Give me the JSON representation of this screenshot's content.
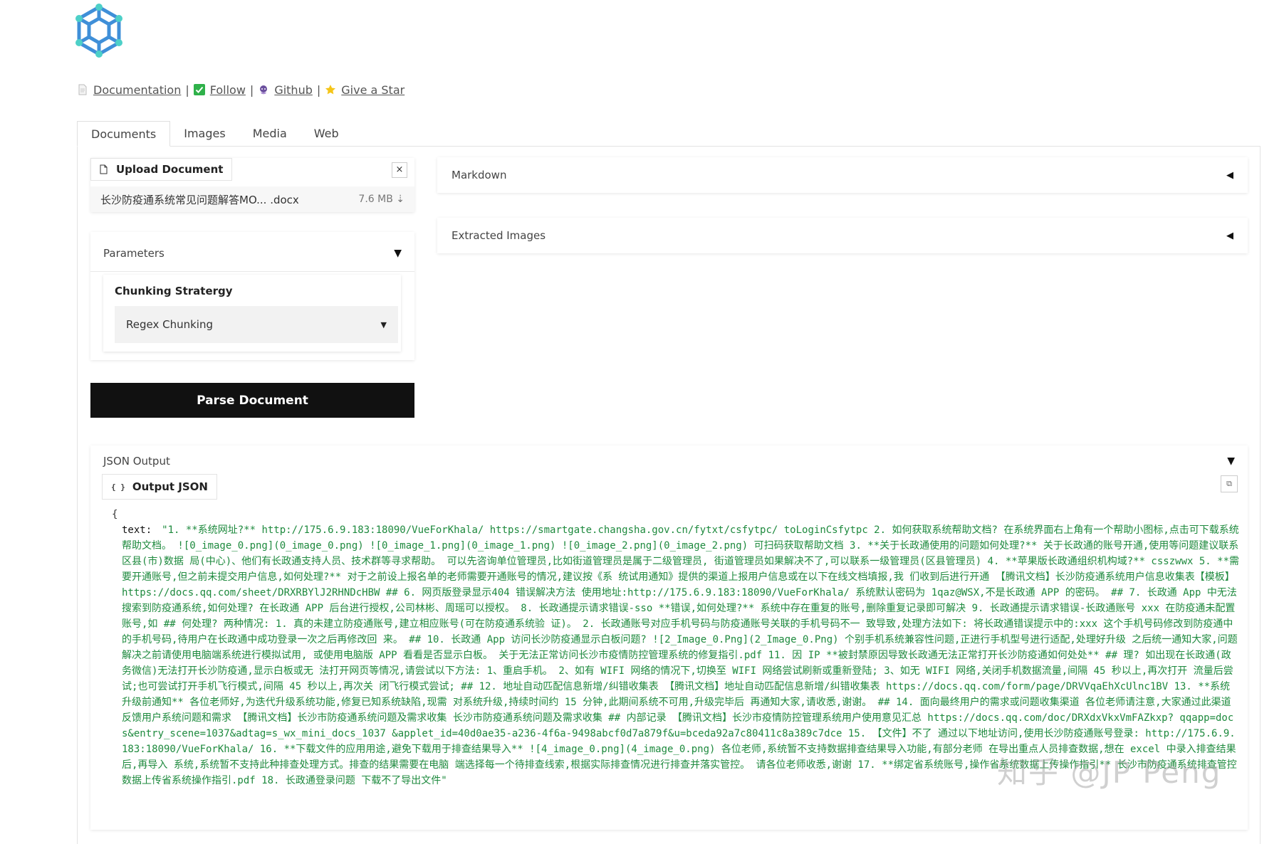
{
  "links": {
    "documentation": "Documentation",
    "follow": "Follow",
    "github": "Github",
    "give_star": "Give a Star",
    "separator": "|"
  },
  "tabs": [
    {
      "label": "Documents",
      "active": true
    },
    {
      "label": "Images",
      "active": false
    },
    {
      "label": "Media",
      "active": false
    },
    {
      "label": "Web",
      "active": false
    }
  ],
  "upload": {
    "label": "Upload Document",
    "close": "×",
    "file_name": "长沙防疫通系统常见问题解答MO... .docx",
    "file_size": "7.6 MB ⇣"
  },
  "parameters": {
    "title": "Parameters",
    "caret": "▼",
    "chunking_label": "Chunking Stratergy",
    "chunking_value": "Regex Chunking"
  },
  "parse_button": "Parse Document",
  "accordions": {
    "markdown": "Markdown",
    "extracted_images": "Extracted Images",
    "caret": "◀"
  },
  "json_output": {
    "title": "JSON Output",
    "caret": "▼",
    "label": "Output JSON",
    "open_brace": "{",
    "key": "text:",
    "text": "\"1. **系统网址?** http://175.6.9.183:18090/VueForKhala/ https://smartgate.changsha.gov.cn/fytxt/csfytpc/ toLoginCsfytpc 2. 如何获取系统帮助文档? 在系统界面右上角有一个帮助小图标,点击可下载系统帮助文档。 ![0_image_0.png](0_image_0.png) ![0_image_1.png](0_image_1.png) ![0_image_2.png](0_image_2.png) 可扫码获取帮助文档 3. **关于长政通使用的问题如何处理?** 关于长政通的账号开通,使用等问题建议联系区县(市)数据 局(中心)、他们有长政通支持人员、技术群等寻求帮助。 可以先咨询单位管理员,比如街道管理员是属于二级管理员, 街道管理员如果解决不了,可以联系一级管理员(区县管理员) 4. **苹果版长政通组织机构域?** csszwwx 5. **需要开通账号,但之前未提交用户信息,如何处理?** 对于之前设上报名单的老师需要开通账号的情况,建议按《系 统试用通知》提供的渠道上报用户信息或在以下在线文档填报,我 们收到后进行开通 【腾讯文档】长沙防疫通系统用户信息收集表【模板】 https://docs.qq.com/sheet/DRXRBYlJ2RHNDcHBW ## 6. 网页版登录显示404 错误解决方法 使用地址:http://175.6.9.183:18090/VueForKhala/ 系统默认密码为 1qaz@WSX,不是长政通 APP 的密码。 ## 7. 长政通 App 中无法搜索到防疫通系统,如何处理? 在长政通 APP 后台进行授权,公司林彬、周瑶可以授权。 8. 长政通提示请求错误-sso **错误,如何处理?** 系统中存在重复的账号,删除重复记录即可解决 9. 长政通提示请求错误-长政通账号 xxx 在防疫通未配置账号,如 ## 何处理? 两种情况: 1. 真的未建立防疫通账号,建立相应账号(可在防疫通系统验 证)。 2. 长政通账号对应手机号码与防疫通账号关联的手机号码不一 致导致,处理方法如下: 将长政通错误提示中的:xxx 这个手机号码修改到防疫通中 的手机号码,待用户在长政通中成功登录一次之后再修改回 来。 ## 10. 长政通 App 访问长沙防疫通显示白板问题? ![2_Image_0.Png](2_Image_0.Png) 个别手机系统兼容性问题,正进行手机型号进行适配,处理好升级 之后统一通知大家,问题解决之前请使用电脑端系统进行模拟试用, 或使用电脑版 APP 看看是否显示白板。 关于无法正常访问长沙市疫情防控管理系统的修复指引.pdf 11. 因 IP **被封禁原因导致长政通无法正常打开长沙防疫通如何处处** ## 理? 如出现在长政通(政务微信)无法打开长沙防疫通,显示白板或无 法打开网页等情况,请尝试以下方法: 1、重启手机。 2、如有 WIFI 网络的情况下,切换至 WIFI 网络尝试刷新或重新登陆; 3、如无 WIFI 网络,关闭手机数据流量,间隔 45 秒以上,再次打开 流量后尝试;也可尝试打开手机飞行模式,间隔 45 秒以上,再次关 闭飞行模式尝试; ## 12. 地址自动匹配信息新增/纠错收集表 【腾讯文档】地址自动匹配信息新增/纠错收集表 https://docs.qq.com/form/page/DRVVqaEhXcUlnc1BV 13. **系统升级前通知** 各位老师好,为迭代升级系统功能,修复已知系统缺陷,现需 对系统升级,持续时间约 15 分钟,此期间系统不可用,升级完毕后 再通知大家,请收悉,谢谢。 ## 14. 面向最终用户的需求或问题收集渠道 各位老师请注意,大家通过此渠道反馈用户系统问题和需求 【腾讯文档】长沙市防疫通系统问题及需求收集 长沙市防疫通系统问题及需求收集 ## 内部记录 【腾讯文档】长沙市疫情防控管理系统用户使用意见汇总 https://docs.qq.com/doc/DRXdxVkxVmFAZkxp? qqapp=docs&entry_scene=1037&adtag=s_wx_mini_docs_1037 &applet_id=40d0ae35-a236-4f6a-9498abcf0d7a879f&u=bceda92a7c80411c8a389c7dce 15. 【文件】不了 通过以下地址访问,使用长沙防疫通账号登录: http://175.6.9.183:18090/VueForKhala/ 16. **下载文件的应用用途,避免下载用于排查结果导入** ![4_image_0.png](4_image_0.png) 各位老师,系统暂不支持数据排查结果导入功能,有部分老师 在导出重点人员排查数据,想在 excel 中录入排查结果后,再导入 系统,系统暂不支持此种排查处理方式。排查的结果需要在电脑 端选择每一个待排查线索,根据实际排查情况进行排查并落实管控。 请各位老师收悉,谢谢 17. **绑定省系统账号,操作省系统数据上传操作指引** 长沙市防疫通系统排查管控数据上传省系统操作指引.pdf 18. 长政通登录问题 下载不了导出文件\""
  },
  "watermark": "知乎 @JP Peng",
  "colors": {
    "primary_button": "#111111",
    "json_string": "#1e8a3e",
    "logo": "#3b8fd9"
  }
}
